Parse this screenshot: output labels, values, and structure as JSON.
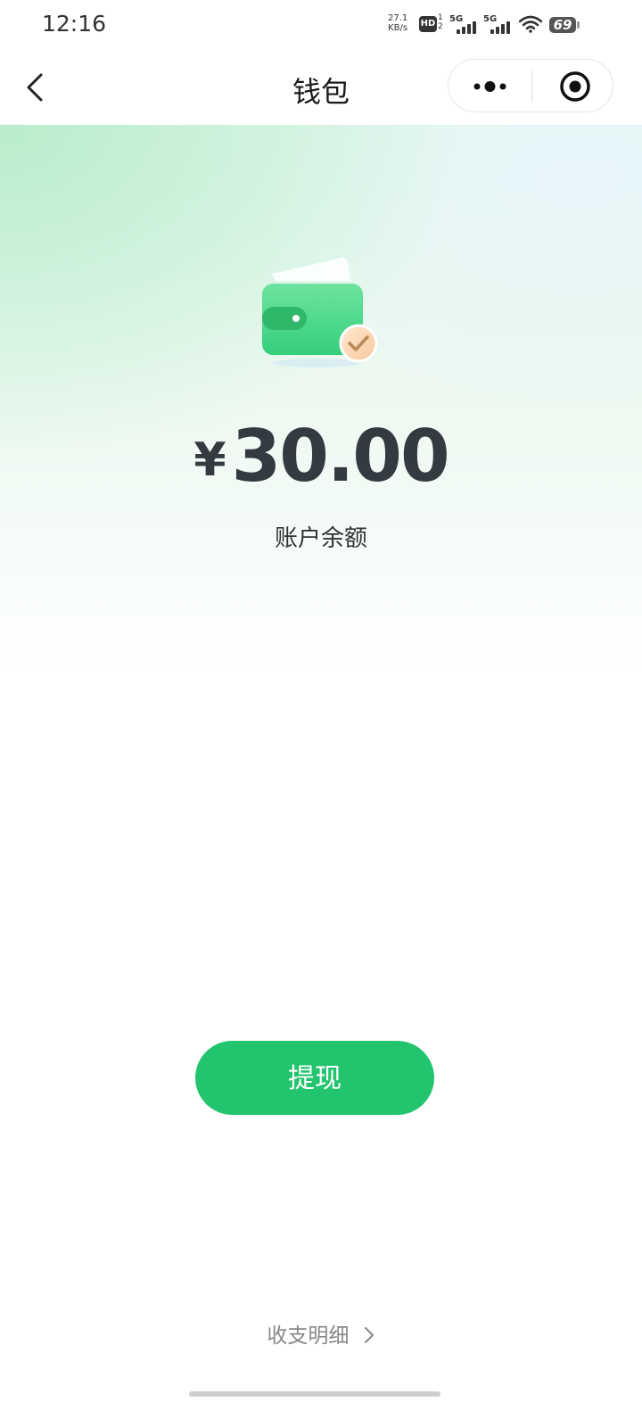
{
  "status_bar": {
    "time": "12:16",
    "net_speed_value": "27.1",
    "net_speed_unit": "KB/s",
    "hd_label": "HD",
    "sim_slots": "1 2",
    "signal1_label": "5G",
    "signal2_label": "5G",
    "battery_level": "69"
  },
  "nav": {
    "title": "钱包",
    "back_icon": "chevron-left-icon",
    "more_icon": "more-dots-icon",
    "close_icon": "target-circle-icon"
  },
  "wallet": {
    "icon": "wallet-check-icon",
    "currency": "¥",
    "amount": "30.00",
    "balance_label": "账户余额",
    "withdraw_label": "提现",
    "details_label": "收支明细",
    "details_icon": "chevron-right-icon"
  },
  "colors": {
    "accent": "#22c56d",
    "amount_text": "#333a40"
  }
}
